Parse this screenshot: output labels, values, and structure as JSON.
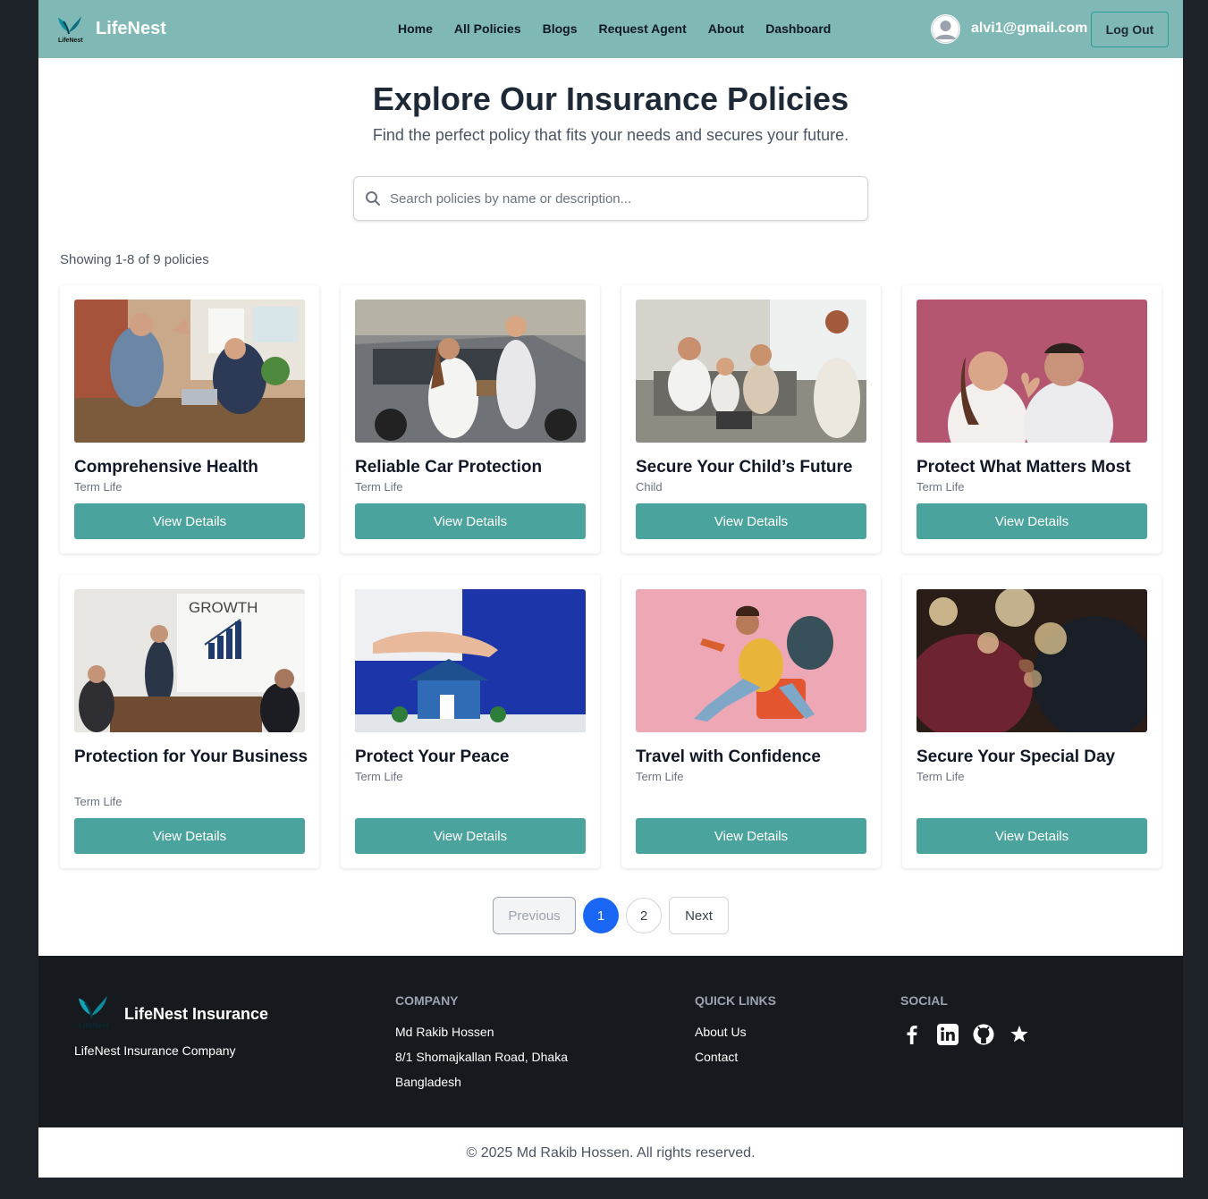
{
  "nav": {
    "brand": "LifeNest",
    "links": [
      "Home",
      "All Policies",
      "Blogs",
      "Request Agent",
      "About",
      "Dashboard"
    ],
    "user_email": "alvi1@gmail.com",
    "logout_label": "Log Out"
  },
  "hero": {
    "title": "Explore Our Insurance Policies",
    "subtitle": "Find the perfect policy that fits your needs and secures your future."
  },
  "search": {
    "placeholder": "Search policies by name or description...",
    "value": ""
  },
  "showing_text": "Showing 1-8 of 9 policies",
  "policies": [
    {
      "title": "Comprehensive Health",
      "category": "Term Life",
      "button": "View Details"
    },
    {
      "title": "Reliable Car Protection",
      "category": "Term Life",
      "button": "View Details"
    },
    {
      "title": "Secure Your Child’s Future",
      "category": "Child",
      "button": "View Details"
    },
    {
      "title": "Protect What Matters Most",
      "category": "Term Life",
      "button": "View Details"
    },
    {
      "title": "Protection for Your Business",
      "category": "Term Life",
      "button": "View Details"
    },
    {
      "title": "Protect Your Peace",
      "category": "Term Life",
      "button": "View Details"
    },
    {
      "title": "Travel with Confidence",
      "category": "Term Life",
      "button": "View Details"
    },
    {
      "title": "Secure Your Special Day",
      "category": "Term Life",
      "button": "View Details"
    }
  ],
  "image_text": {
    "growth_board": "GROWTH",
    "logo_text": "LifeNest"
  },
  "pagination": {
    "previous": "Previous",
    "pages": [
      "1",
      "2"
    ],
    "current": "1",
    "next": "Next"
  },
  "footer": {
    "brand": "LifeNest Insurance",
    "company_name": "LifeNest Insurance Company",
    "company_heading": "COMPANY",
    "company_lines": [
      "Md Rakib Hossen",
      "8/1 Shomajkallan Road, Dhaka",
      "Bangladesh"
    ],
    "quick_links_heading": "QUICK LINKS",
    "quick_links": [
      "About Us",
      "Contact"
    ],
    "social_heading": "SOCIAL",
    "social_icons": [
      "facebook-icon",
      "linkedin-icon",
      "github-icon",
      "star-icon"
    ],
    "copyright": "© 2025 Md Rakib Hossen. All rights reserved."
  },
  "colors": {
    "navbar": "#7fb8b4",
    "accent": "#4aa39c",
    "active_page": "#1a66f5",
    "footer": "#161a1f"
  }
}
